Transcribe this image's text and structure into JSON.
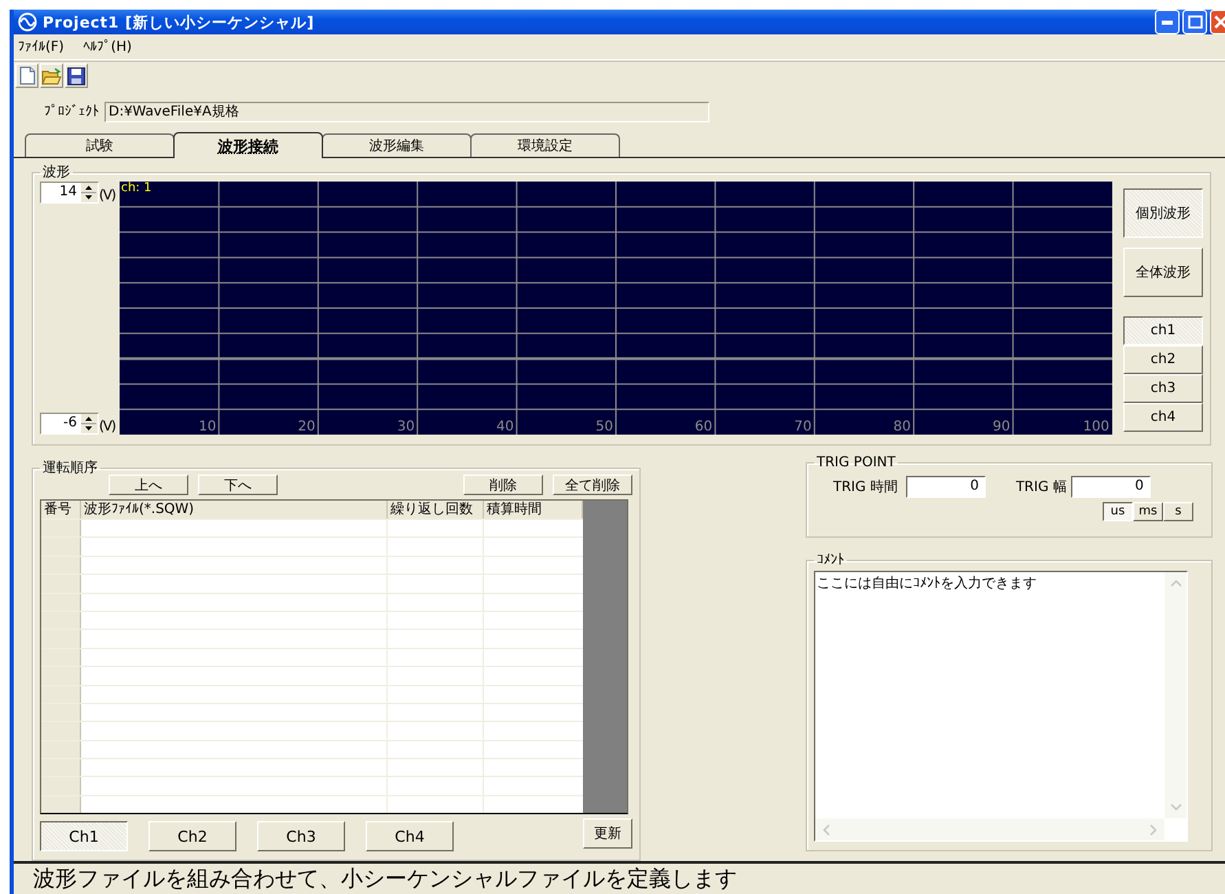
{
  "window": {
    "title": "Project1 [新しい小シーケンシャル]"
  },
  "menu": [
    {
      "label": "ﾌｧｲﾙ(F)"
    },
    {
      "label": "ﾍﾙﾌﾟ(H)"
    }
  ],
  "project": {
    "label": "ﾌﾟﾛｼﾞｪｸﾄ",
    "value": "D:¥WaveFile¥A規格"
  },
  "tabs": [
    {
      "label": "試験",
      "selected": false
    },
    {
      "label": "波形接続",
      "selected": true
    },
    {
      "label": "波形編集",
      "selected": false
    },
    {
      "label": "環境設定",
      "selected": false
    }
  ],
  "waveform": {
    "title": "波形",
    "upper": {
      "value": "14",
      "unit": "(V)"
    },
    "lower": {
      "value": "-6",
      "unit": "(V)"
    },
    "plot": {
      "channel_label": "ch: 1",
      "x_tick_labels": [
        "10",
        "20",
        "30",
        "40",
        "50",
        "60",
        "70",
        "80",
        "90",
        "100"
      ]
    },
    "view_buttons": [
      {
        "label": "個別波形",
        "selected": true
      },
      {
        "label": "全体波形",
        "selected": false
      }
    ],
    "channels": [
      {
        "label": "ch1",
        "selected": true
      },
      {
        "label": "ch2",
        "selected": false
      },
      {
        "label": "ch3",
        "selected": false
      },
      {
        "label": "ch4",
        "selected": false
      }
    ]
  },
  "sequence": {
    "title": "運転順序",
    "move_buttons": [
      "上へ",
      "下へ"
    ],
    "delete_buttons": [
      "削除",
      "全て削除"
    ],
    "table": {
      "columns": [
        "番号",
        "波形ﾌｧｲﾙ(*.SQW)",
        "繰り返し回数",
        "積算時間"
      ]
    },
    "channel_buttons": [
      {
        "label": "Ch1",
        "selected": true
      },
      {
        "label": "Ch2",
        "selected": false
      },
      {
        "label": "Ch3",
        "selected": false
      },
      {
        "label": "Ch4",
        "selected": false
      }
    ],
    "update_button": "更新"
  },
  "trig": {
    "title": "TRIG POINT",
    "time": {
      "label": "TRIG 時間",
      "value": "0"
    },
    "width": {
      "label": "TRIG 幅",
      "value": "0"
    },
    "units": [
      {
        "label": "us",
        "selected": true
      },
      {
        "label": "ms",
        "selected": false
      },
      {
        "label": "s",
        "selected": false
      }
    ]
  },
  "comment": {
    "title": "ｺﾒﾝﾄ",
    "value": "ここには自由にｺﾒﾝﾄを入力できます"
  },
  "status_bar": {
    "text": "波形ファイルを組み合わせて、小シーケンシャルファイルを定義します"
  }
}
